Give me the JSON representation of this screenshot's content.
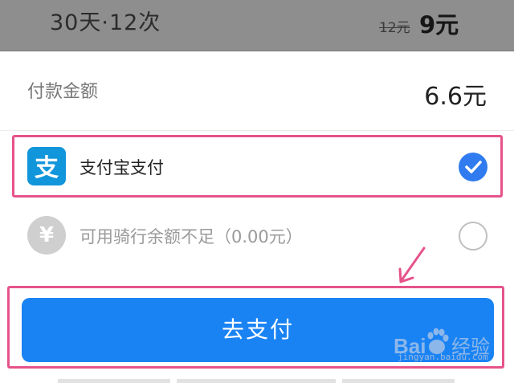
{
  "plan": {
    "title": "30天·12次",
    "original_price": "12元",
    "price": "9元"
  },
  "payment": {
    "amount_label": "付款金额",
    "amount_value": "6.6元"
  },
  "options": [
    {
      "label": "支付宝支付",
      "icon": "alipay-icon",
      "selected": true
    },
    {
      "label": "可用骑行余额不足（0.00元）",
      "icon": "yen-icon",
      "selected": false
    }
  ],
  "pay_button": {
    "label": "去支付"
  },
  "watermark": {
    "brand": "Bai",
    "brand_suffix": "经验",
    "url": "jingyan.baidu.com"
  },
  "colors": {
    "accent": "#1a83f4",
    "highlight": "#e6538a",
    "alipay": "#1296db"
  }
}
